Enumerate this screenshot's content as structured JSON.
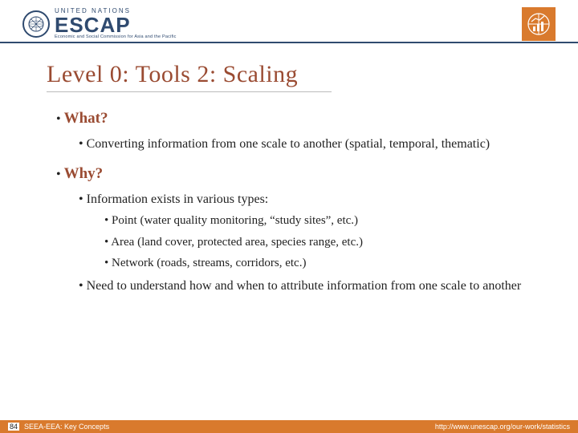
{
  "header": {
    "org_top": "UNITED NATIONS",
    "org_main": "ESCAP",
    "org_sub": "Economic and Social Commission for Asia and the Pacific"
  },
  "title": "Level 0: Tools 2: Scaling",
  "bullets": {
    "what_label": "What?",
    "what_item": "Converting information from one scale to another (spatial, temporal, thematic)",
    "why_label": "Why?",
    "why_intro": "Information exists in various types:",
    "why_sub1": "Point (water quality monitoring, “study sites”, etc.)",
    "why_sub2": "Area (land cover, protected area, species range, etc.)",
    "why_sub3": "Network (roads, streams, corridors, etc.)",
    "why_need": "Need to understand how and when to attribute information from one scale to another"
  },
  "footer": {
    "page": "84",
    "doc_title": "SEEA-EEA: Key Concepts",
    "url": "http://www.unescap.org/our-work/statistics"
  }
}
